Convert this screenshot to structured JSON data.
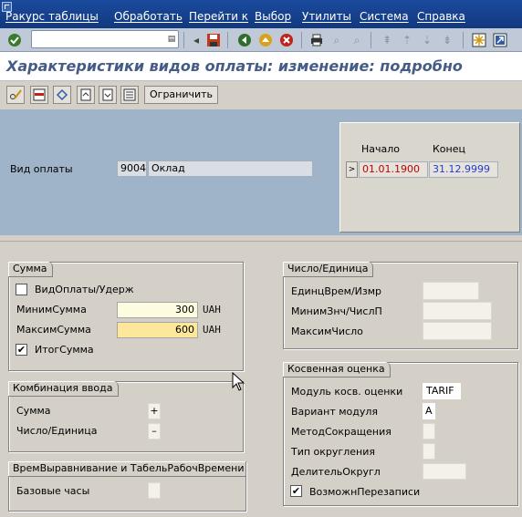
{
  "menubar": {
    "items": [
      "Ракурс таблицы",
      "Обработать",
      "Перейти к",
      "Выбор",
      "Утилиты",
      "Система",
      "Справка"
    ]
  },
  "systoolbar": {
    "command_field_value": ""
  },
  "title": "Характеристики видов оплаты: изменение: подробно",
  "apptoolbar": {
    "restrict_label": "Ограничить"
  },
  "header": {
    "wage_type_label": "Вид оплаты",
    "wage_type_code": "9004",
    "wage_type_text": "Оклад",
    "start_label": "Начало",
    "end_label": "Конец",
    "start_date": "01.01.1900",
    "end_date": "31.12.9999",
    "start_color": "#c00000",
    "end_color": "#1f3fd0"
  },
  "amount_group": {
    "title": "Сумма",
    "deduction_label": "ВидОплаты/Удерж",
    "deduction_checked": false,
    "min_label": "МинимСумма",
    "min_value": "300",
    "min_unit": "UAH",
    "max_label": "МаксимСумма",
    "max_value": "600",
    "max_unit": "UAH",
    "total_label": "ИтогСумма",
    "total_checked": true
  },
  "input_combo_group": {
    "title": "Комбинация ввода",
    "amount_label": "Сумма",
    "amount_value": "+",
    "number_label": "Число/Единица",
    "number_value": "–"
  },
  "time_group": {
    "title": "ВремВыравнивание и ТабельРабочВремени",
    "base_hours_label": "Базовые часы",
    "base_hours_value": ""
  },
  "number_group": {
    "title": "Число/Единица",
    "unit_label": "ЕдинцВрем/Измр",
    "unit_value": "",
    "min_label": "МинимЗнч/ЧислП",
    "min_value": "",
    "max_label": "МаксимЧисло",
    "max_value": ""
  },
  "indirect_group": {
    "title": "Косвенная оценка",
    "module_label": "Модуль косв. оценки",
    "module_value": "TARIF",
    "variant_label": "Вариант модуля",
    "variant_value": "A",
    "reduction_label": "МетодСокращения",
    "reduction_value": "",
    "rounding_label": "Тип округления",
    "rounding_value": "",
    "divisor_label": "ДелительОкругл",
    "divisor_value": "",
    "overwrite_label": "ВозможнПерезаписи",
    "overwrite_checked": true
  },
  "icons": {
    "check": "✔",
    "back": "◀",
    "exit": "▲",
    "cancel": "✖"
  }
}
